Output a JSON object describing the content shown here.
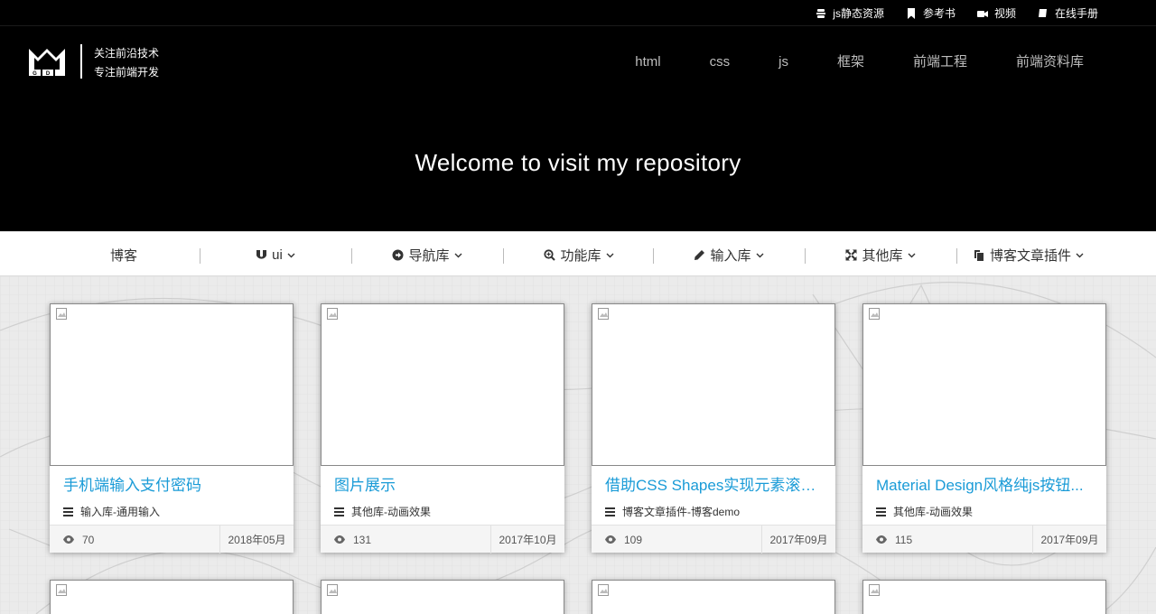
{
  "topbar": {
    "links": [
      {
        "label": "js静态资源",
        "icon": "server-icon"
      },
      {
        "label": "参考书",
        "icon": "bookmark-icon"
      },
      {
        "label": "视频",
        "icon": "video-icon"
      },
      {
        "label": "在线手册",
        "icon": "book-icon"
      }
    ]
  },
  "header": {
    "logo_text": "MGD",
    "slogan_line1": "关注前沿技术",
    "slogan_line2": "专注前端开发",
    "nav": [
      "html",
      "css",
      "js",
      "框架",
      "前端工程",
      "前端资料库"
    ],
    "hero_title": "Welcome to visit my repository"
  },
  "categories": [
    {
      "label": "博客",
      "icon": ""
    },
    {
      "label": "ui",
      "icon": "magnet-icon"
    },
    {
      "label": "导航库",
      "icon": "arrow-circle-icon"
    },
    {
      "label": "功能库",
      "icon": "zoom-icon"
    },
    {
      "label": "输入库",
      "icon": "pencil-icon"
    },
    {
      "label": "其他库",
      "icon": "expand-icon"
    },
    {
      "label": "博客文章插件",
      "icon": "copy-icon"
    }
  ],
  "cards": [
    {
      "title": "手机端输入支付密码",
      "category": "输入库-通用输入",
      "views": "70",
      "date": "2018年05月"
    },
    {
      "title": "图片展示",
      "category": "其他库-动画效果",
      "views": "131",
      "date": "2017年10月"
    },
    {
      "title": "借助CSS Shapes实现元素滚动...",
      "category": "博客文章插件-博客demo",
      "views": "109",
      "date": "2017年09月"
    },
    {
      "title": "Material Design风格纯js按钮...",
      "category": "其他库-动画效果",
      "views": "115",
      "date": "2017年09月"
    }
  ],
  "colors": {
    "title_link": "#1a9bd7",
    "header_bg": "#000000",
    "main_bg": "#ebebeb"
  }
}
